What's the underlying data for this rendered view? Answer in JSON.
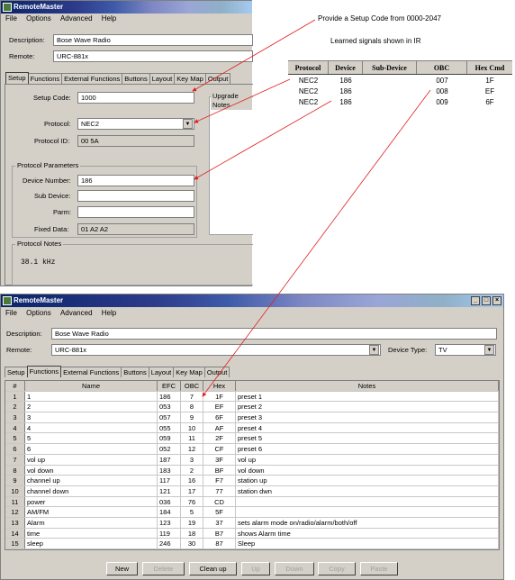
{
  "annotations": {
    "setup_code_note": "Provide a Setup Code from 0000-2047",
    "learned_note": "Learned signals shown in IR"
  },
  "learned_table": {
    "headers": [
      "Protocol",
      "Device",
      "Sub-Device",
      "OBC",
      "Hex Cmd"
    ],
    "rows": [
      {
        "protocol": "NEC2",
        "device": "186",
        "subdevice": "",
        "obc": "007",
        "hex": "1F"
      },
      {
        "protocol": "NEC2",
        "device": "186",
        "subdevice": "",
        "obc": "008",
        "hex": "EF"
      },
      {
        "protocol": "NEC2",
        "device": "186",
        "subdevice": "",
        "obc": "009",
        "hex": "6F"
      }
    ]
  },
  "win1": {
    "title": "RemoteMaster",
    "menu": [
      "File",
      "Options",
      "Advanced",
      "Help"
    ],
    "description_label": "Description:",
    "description_value": "Bose Wave Radio",
    "remote_label": "Remote:",
    "remote_value": "URC-881x",
    "tabs": [
      "Setup",
      "Functions",
      "External Functions",
      "Buttons",
      "Layout",
      "Key Map",
      "Output"
    ],
    "setup_code_label": "Setup Code:",
    "setup_code_value": "1000",
    "protocol_label": "Protocol:",
    "protocol_value": "NEC2",
    "protocol_id_label": "Protocol ID:",
    "protocol_id_value": "00 5A",
    "params_group": "Protocol Parameters",
    "device_number_label": "Device Number:",
    "device_number_value": "186",
    "sub_device_label": "Sub Device:",
    "sub_device_value": "",
    "parm_label": "Parm:",
    "parm_value": "",
    "fixed_data_label": "Fixed Data:",
    "fixed_data_value": "01 A2 A2",
    "upgrade_notes_label": "Upgrade Notes",
    "protocol_notes_label": "Protocol Notes",
    "protocol_notes_value": "38.1 kHz"
  },
  "win2": {
    "title": "RemoteMaster",
    "controls": [
      "_",
      "□",
      "×"
    ],
    "menu": [
      "File",
      "Options",
      "Advanced",
      "Help"
    ],
    "description_label": "Description:",
    "description_value": "Bose Wave Radio",
    "remote_label": "Remote:",
    "remote_value": "URC-881x",
    "device_type_label": "Device Type:",
    "device_type_value": "TV",
    "tabs": [
      "Setup",
      "Functions",
      "External Functions",
      "Buttons",
      "Layout",
      "Key Map",
      "Output"
    ],
    "table_headers": [
      "#",
      "Name",
      "EFC",
      "OBC",
      "Hex",
      "Notes"
    ],
    "rows": [
      {
        "n": "1",
        "name": "1",
        "efc": "186",
        "obc": "7",
        "hex": "1F",
        "notes": "preset 1"
      },
      {
        "n": "2",
        "name": "2",
        "efc": "053",
        "obc": "8",
        "hex": "EF",
        "notes": "preset 2"
      },
      {
        "n": "3",
        "name": "3",
        "efc": "057",
        "obc": "9",
        "hex": "6F",
        "notes": "preset 3"
      },
      {
        "n": "4",
        "name": "4",
        "efc": "055",
        "obc": "10",
        "hex": "AF",
        "notes": "preset 4"
      },
      {
        "n": "5",
        "name": "5",
        "efc": "059",
        "obc": "11",
        "hex": "2F",
        "notes": "preset 5"
      },
      {
        "n": "6",
        "name": "6",
        "efc": "052",
        "obc": "12",
        "hex": "CF",
        "notes": "preset 6"
      },
      {
        "n": "7",
        "name": "vol up",
        "efc": "187",
        "obc": "3",
        "hex": "3F",
        "notes": "vol up"
      },
      {
        "n": "8",
        "name": "vol down",
        "efc": "183",
        "obc": "2",
        "hex": "BF",
        "notes": "vol down"
      },
      {
        "n": "9",
        "name": "channel up",
        "efc": "117",
        "obc": "16",
        "hex": "F7",
        "notes": "station up"
      },
      {
        "n": "10",
        "name": "channel down",
        "efc": "121",
        "obc": "17",
        "hex": "77",
        "notes": "station dwn"
      },
      {
        "n": "11",
        "name": "power",
        "efc": "036",
        "obc": "76",
        "hex": "CD",
        "notes": ""
      },
      {
        "n": "12",
        "name": "AM/FM",
        "efc": "184",
        "obc": "5",
        "hex": "5F",
        "notes": ""
      },
      {
        "n": "13",
        "name": "Alarm",
        "efc": "123",
        "obc": "19",
        "hex": "37",
        "notes": "sets alarm mode on/radio/alarm/both/off"
      },
      {
        "n": "14",
        "name": "time",
        "efc": "119",
        "obc": "18",
        "hex": "B7",
        "notes": "shows Alarm time"
      },
      {
        "n": "15",
        "name": "sleep",
        "efc": "246",
        "obc": "30",
        "hex": "87",
        "notes": "Sleep"
      }
    ],
    "buttons": [
      {
        "label": "New",
        "enabled": true
      },
      {
        "label": "Delete",
        "enabled": false
      },
      {
        "label": "Clean up",
        "enabled": true
      },
      {
        "label": "Up",
        "enabled": false
      },
      {
        "label": "Down",
        "enabled": false
      },
      {
        "label": "Copy",
        "enabled": false
      },
      {
        "label": "Paste",
        "enabled": false
      }
    ]
  },
  "colors": {
    "window_bg": "#d4d0c8",
    "arrow": "#e02020",
    "title_dark": "#0a246a"
  }
}
